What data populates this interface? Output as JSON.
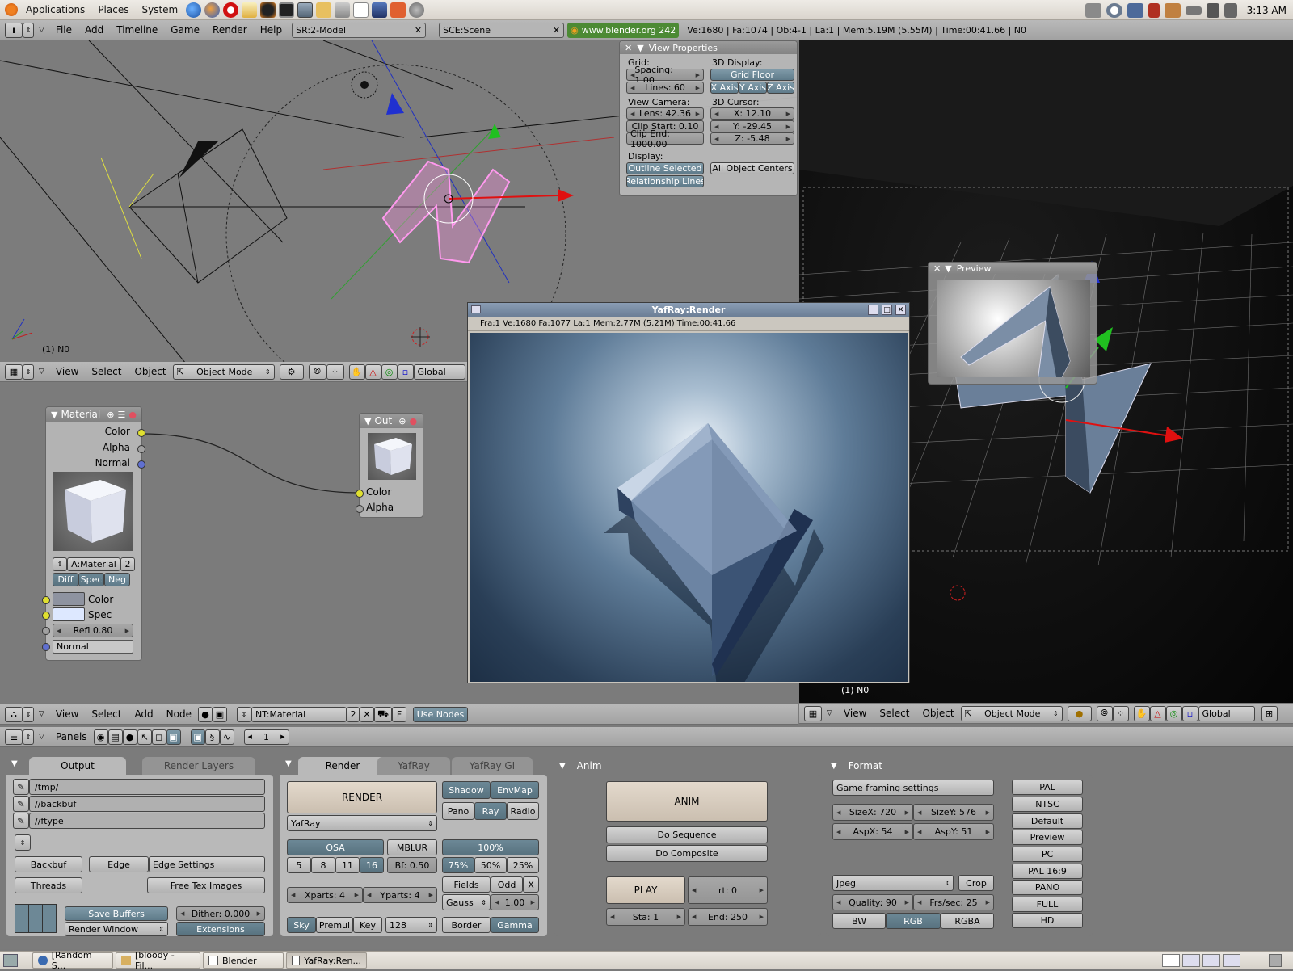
{
  "gnome": {
    "menus": [
      "Applications",
      "Places",
      "System"
    ],
    "clock": "3:13 AM"
  },
  "top_header": {
    "menus": [
      "File",
      "Add",
      "Timeline",
      "Game",
      "Render",
      "Help"
    ],
    "screen": "SR:2-Model",
    "scene": "SCE:Scene",
    "url": "www.blender.org 242",
    "stats": "Ve:1680 | Fa:1074 | Ob:4-1 | La:1  | Mem:5.19M (5.55M)  | Time:00:41.66 | N0"
  },
  "viewport1": {
    "frame_label": "(1) N0",
    "menus": [
      "View",
      "Select",
      "Object"
    ],
    "mode": "Object Mode",
    "orientation": "Global"
  },
  "view_properties": {
    "title": "View Properties",
    "grid_label": "Grid:",
    "spacing": "Spacing: 1.00",
    "lines": "Lines: 60",
    "display3d_label": "3D Display:",
    "grid_floor": "Grid Floor",
    "x_axis": "X Axis",
    "y_axis": "Y Axis",
    "z_axis": "Z Axis",
    "view_camera_label": "View Camera:",
    "lens": "Lens: 42.36",
    "clip_start": "Clip Start: 0.10",
    "clip_end": "Clip End: 1000.00",
    "cursor_label": "3D Cursor:",
    "cursor_x": "X: 12.10",
    "cursor_y": "Y: -29.45",
    "cursor_z": "Z: -5.48",
    "display_label": "Display:",
    "outline_selected": "Outline Selected",
    "all_object_centers": "All Object Centers",
    "relationship_lines": "Relationship Lines"
  },
  "viewport2": {
    "frame_label": "(1) N0",
    "preview_title": "Preview",
    "menus": [
      "View",
      "Select",
      "Object"
    ],
    "mode": "Object Mode",
    "orientation": "Global"
  },
  "nodes": {
    "material_node": {
      "title": "Material",
      "outputs": [
        "Color",
        "Alpha",
        "Normal"
      ],
      "material_name": "A:Material",
      "users": "2",
      "toggles": [
        "Diff",
        "Spec",
        "Neg"
      ],
      "inputs": [
        "Color",
        "Spec"
      ],
      "refl": "Refl 0.80",
      "normal_input": "Normal"
    },
    "out_node": {
      "title": "Out",
      "inputs": [
        "Color",
        "Alpha"
      ]
    },
    "header": {
      "menus": [
        "View",
        "Select",
        "Add",
        "Node"
      ],
      "tree": "NT:Material",
      "users": "2",
      "f": "F",
      "use_nodes": "Use Nodes"
    }
  },
  "yafray": {
    "title": "YafRay:Render",
    "status": "Fra:1  Ve:1680 Fa:1077 La:1 Mem:2.77M (5.21M) Time:00:41.66"
  },
  "buttons_header": {
    "panels": "Panels",
    "frame": "1"
  },
  "output": {
    "tabs": [
      "Output",
      "Render Layers"
    ],
    "paths": [
      "/tmp/",
      "//backbuf",
      "//ftype"
    ],
    "backbuf": "Backbuf",
    "edge": "Edge",
    "edge_settings": "Edge Settings",
    "threads": "Threads",
    "free_tex": "Free Tex Images",
    "save_buffers": "Save Buffers",
    "dither": "Dither: 0.000",
    "render_window": "Render Window",
    "extensions": "Extensions"
  },
  "render": {
    "tabs": [
      "Render",
      "YafRay",
      "YafRay GI"
    ],
    "render_btn": "RENDER",
    "engine": "YafRay",
    "shadow": "Shadow",
    "envmap": "EnvMap",
    "pano": "Pano",
    "ray": "Ray",
    "radio": "Radio",
    "osa": "OSA",
    "osa_vals": [
      "5",
      "8",
      "11",
      "16"
    ],
    "mblur": "MBLUR",
    "bf": "Bf: 0.50",
    "pct100": "100%",
    "pcts": [
      "75%",
      "50%",
      "25%"
    ],
    "xparts": "Xparts: 4",
    "yparts": "Yparts: 4",
    "fields": "Fields",
    "odd": "Odd",
    "x": "X",
    "gauss": "Gauss",
    "gauss_val": "1.00",
    "sky": "Sky",
    "premul": "Premul",
    "key": "Key",
    "bits": "128",
    "border": "Border",
    "gamma": "Gamma"
  },
  "anim": {
    "title": "Anim",
    "anim_btn": "ANIM",
    "do_sequence": "Do Sequence",
    "do_composite": "Do Composite",
    "play": "PLAY",
    "rt": "rt: 0",
    "sta": "Sta: 1",
    "end": "End: 250"
  },
  "format": {
    "title": "Format",
    "game_framing": "Game framing settings",
    "sizex": "SizeX: 720",
    "sizey": "SizeY: 576",
    "aspx": "AspX: 54",
    "aspy": "AspY: 51",
    "filetype": "Jpeg",
    "crop": "Crop",
    "quality": "Quality: 90",
    "fps": "Frs/sec: 25",
    "bw": "BW",
    "rgb": "RGB",
    "rgba": "RGBA",
    "presets": [
      "PAL",
      "NTSC",
      "Default",
      "Preview",
      "PC",
      "PAL 16:9",
      "PANO",
      "FULL",
      "HD"
    ]
  },
  "taskbar": {
    "tasks": [
      "[Random S...",
      "[bloody - Fil...",
      "Blender",
      "YafRay:Ren..."
    ]
  }
}
